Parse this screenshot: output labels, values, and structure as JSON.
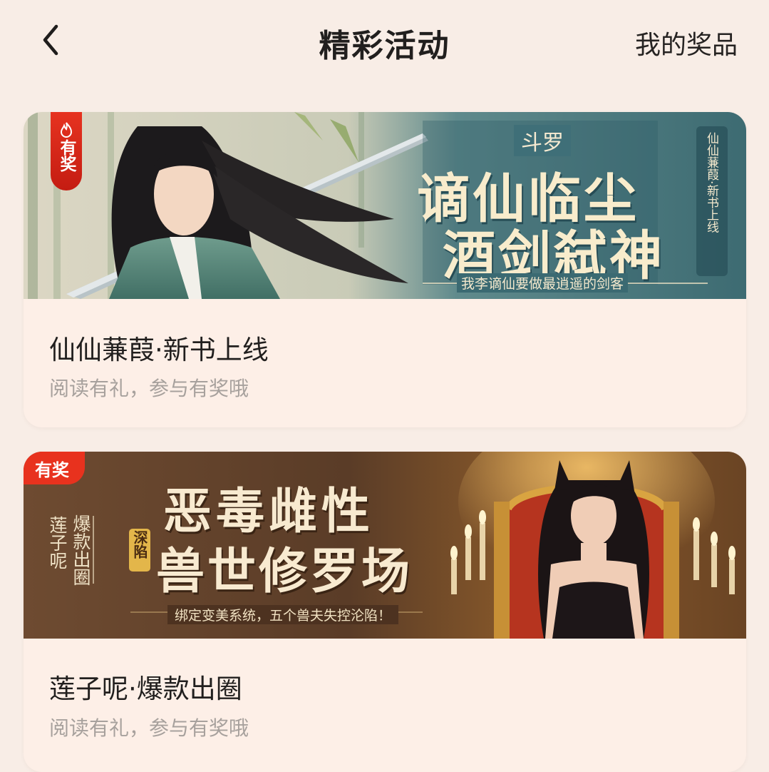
{
  "header": {
    "title": "精彩活动",
    "prizes_label": "我的奖品"
  },
  "activities": [
    {
      "badge": "有奖",
      "banner": {
        "series": "斗罗",
        "headline_line1": "谪仙临尘",
        "headline_line2": "酒剑弑神",
        "tagline": "我李谪仙要做最逍遥的剑客",
        "side_text": "仙仙蒹葭·新书上线"
      },
      "title": "仙仙蒹葭·新书上线",
      "subtitle": "阅读有礼，参与有奖哦"
    },
    {
      "badge": "有奖",
      "banner": {
        "author": "莲子呢",
        "side_tag": "爆款出圈",
        "headline_line1": "恶毒雌性",
        "headline_line2": "兽世修罗场",
        "small_tag": "深陷",
        "tagline": "绑定变美系统，五个兽夫失控沦陷！"
      },
      "title": "莲子呢·爆款出圈",
      "subtitle": "阅读有礼，参与有奖哦"
    }
  ],
  "colors": {
    "background": "#f8ede6",
    "card": "#fdefe7",
    "badge_red": "#e8321e",
    "muted_text": "#a7a19d"
  }
}
